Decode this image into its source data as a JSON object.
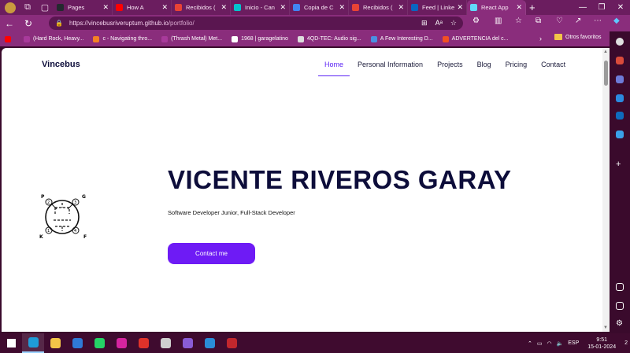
{
  "browser": {
    "tabs": [
      {
        "label": "Pages",
        "color": "#24292f"
      },
      {
        "label": "How A",
        "color": "#ff0000"
      },
      {
        "label": "Recibidos (",
        "color": "#ea4335"
      },
      {
        "label": "Inicio - Can",
        "color": "#00c4cc"
      },
      {
        "label": "Copia de C",
        "color": "#4285f4"
      },
      {
        "label": "Recibidos (",
        "color": "#ea4335"
      },
      {
        "label": "Feed | Linke",
        "color": "#0a66c2"
      },
      {
        "label": "React App",
        "color": "#61dafb",
        "active": true
      }
    ],
    "url": "https://vincebusriveruptum.github.io/portfolio/",
    "url_host": "https://vincebusriveruptum.github.io",
    "url_path": "/portfolio/",
    "bookmarks": [
      {
        "label": "",
        "color": "#ff0000"
      },
      {
        "label": "(Hard Rock, Heavy...",
        "color": "#a83a9b"
      },
      {
        "label": "c - Navigating thro...",
        "color": "#f48024"
      },
      {
        "label": "(Thrash Metal) Met...",
        "color": "#a83a9b"
      },
      {
        "label": "1968 | garagelatino",
        "color": "#ffffff"
      },
      {
        "label": "4QD-TEC: Audio sig...",
        "color": "#dddddd"
      },
      {
        "label": "A Few Interesting D...",
        "color": "#4a90e2"
      },
      {
        "label": "ADVERTENCIA del c...",
        "color": "#f25022"
      }
    ],
    "other_favorites": "Otros favoritos"
  },
  "site": {
    "brand": "Vincebus",
    "nav": [
      "Home",
      "Personal Information",
      "Projects",
      "Blog",
      "Pricing",
      "Contact"
    ],
    "active_nav": "Home",
    "hero": {
      "name": "VICENTE RIVEROS GARAY",
      "subtitle": "Software Developer Junior, Full-Stack Developer",
      "cta": "Contact me"
    },
    "logo_labels": {
      "p": "P",
      "g": "G",
      "k": "K",
      "f": "F",
      "n1": "1",
      "n2": "2",
      "n3": "3",
      "n4": "4"
    },
    "accent": "#6e1bf5"
  },
  "taskbar": {
    "apps": [
      "start-icon",
      "edge-icon",
      "file-explorer-icon",
      "store-icon",
      "whatsapp-icon",
      "instagram-icon",
      "winamp-icon",
      "printer-icon",
      "visual-studio-icon",
      "vscode-icon",
      "app-icon"
    ],
    "lang": "ESP",
    "time": "9:51",
    "date": "15-01-2024",
    "notifications": "2"
  }
}
